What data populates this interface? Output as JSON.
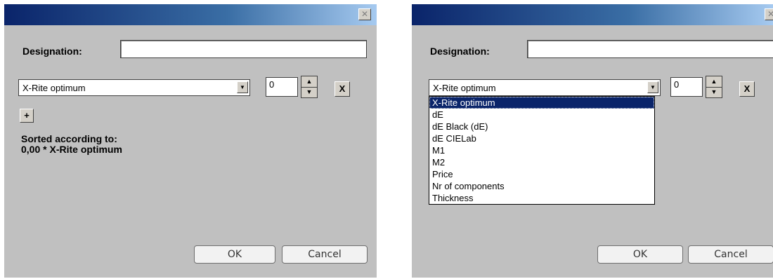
{
  "dialog_left": {
    "close_glyph": "✕",
    "designation_label": "Designation:",
    "designation_value": "",
    "sort_criterion": "X-Rite optimum",
    "weight_value": "0",
    "remove_label": "X",
    "add_label": "+",
    "sorted_header": "Sorted according to:",
    "sorted_expression": "0,00 * X-Rite optimum",
    "ok_label": "OK",
    "cancel_label": "Cancel"
  },
  "dialog_right": {
    "close_glyph": "✕",
    "designation_label": "Designation:",
    "designation_value": "",
    "sort_criterion": "X-Rite optimum",
    "weight_value": "0",
    "remove_label": "X",
    "ok_label": "OK",
    "cancel_label": "Cancel",
    "dropdown_options": [
      "X-Rite optimum",
      "dE",
      "dE Black (dE)",
      "dE CIELab",
      "M1",
      "M2",
      "Price",
      "Nr of components",
      "Thickness"
    ],
    "dropdown_selected_index": 0
  },
  "icons": {
    "combo_arrow": "▼",
    "spin_up": "▲",
    "spin_down": "▼"
  },
  "colors": {
    "dialog_background": "#c0c0c0",
    "titlebar_start": "#0a246a",
    "titlebar_end": "#a6caf0",
    "selection": "#0a246a"
  }
}
